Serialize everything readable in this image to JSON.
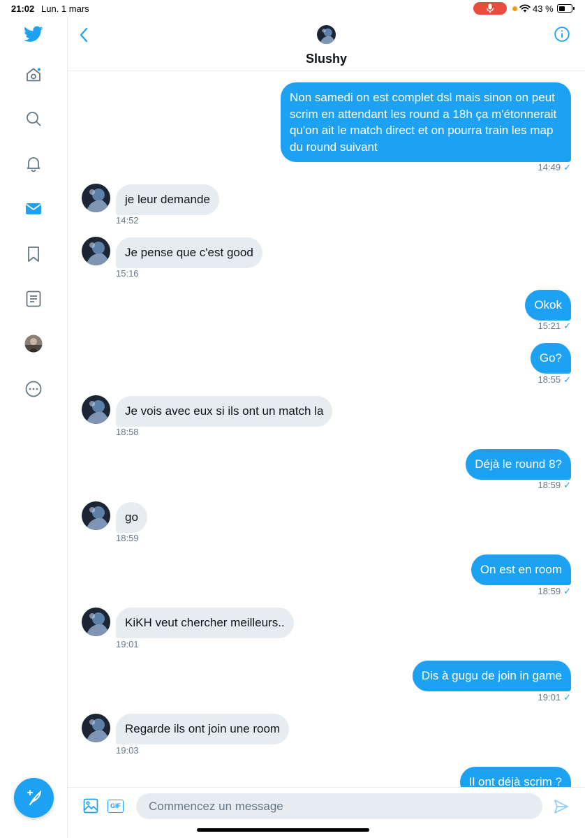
{
  "status_bar": {
    "time": "21:02",
    "date": "Lun. 1 mars",
    "battery": "43 %"
  },
  "header": {
    "name": "Slushy"
  },
  "messages": [
    {
      "dir": "out",
      "text": "Non samedi on est complet dsl mais sinon on peut scrim en attendant les round a 18h ça m'étonnerait qu'on ait le match direct et on pourra train les map du round suivant",
      "time": "14:49"
    },
    {
      "dir": "in",
      "text": "je leur demande",
      "time": "14:52"
    },
    {
      "dir": "in",
      "text": "Je pense que c'est good",
      "time": "15:16"
    },
    {
      "dir": "out",
      "text": "Okok",
      "time": "15:21"
    },
    {
      "dir": "out",
      "text": "Go?",
      "time": "18:55"
    },
    {
      "dir": "in",
      "text": "Je vois avec eux si ils ont un match la",
      "time": "18:58"
    },
    {
      "dir": "out",
      "text": "Déjà le round 8?",
      "time": "18:59"
    },
    {
      "dir": "in",
      "text": "go",
      "time": "18:59"
    },
    {
      "dir": "out",
      "text": "On est en room",
      "time": "18:59"
    },
    {
      "dir": "in",
      "text": "KiKH veut chercher meilleurs..",
      "time": "19:01"
    },
    {
      "dir": "out",
      "text": "Dis à gugu de join in game",
      "time": "19:01"
    },
    {
      "dir": "in",
      "text": "Regarde ils ont join une room",
      "time": "19:03"
    },
    {
      "dir": "out",
      "text": "Il ont déjà scrim ?",
      "time": ""
    }
  ],
  "composer": {
    "placeholder": "Commencez un message",
    "gif_label": "GIF"
  },
  "colors": {
    "accent": "#1da1f2",
    "incoming_bubble": "#e6ecf0",
    "meta_text": "#657786"
  },
  "icons": {
    "sidebar": [
      "twitter-logo-icon",
      "home-icon",
      "search-icon",
      "notifications-icon",
      "messages-icon",
      "bookmarks-icon",
      "lists-icon",
      "profile-avatar",
      "more-icon"
    ]
  }
}
